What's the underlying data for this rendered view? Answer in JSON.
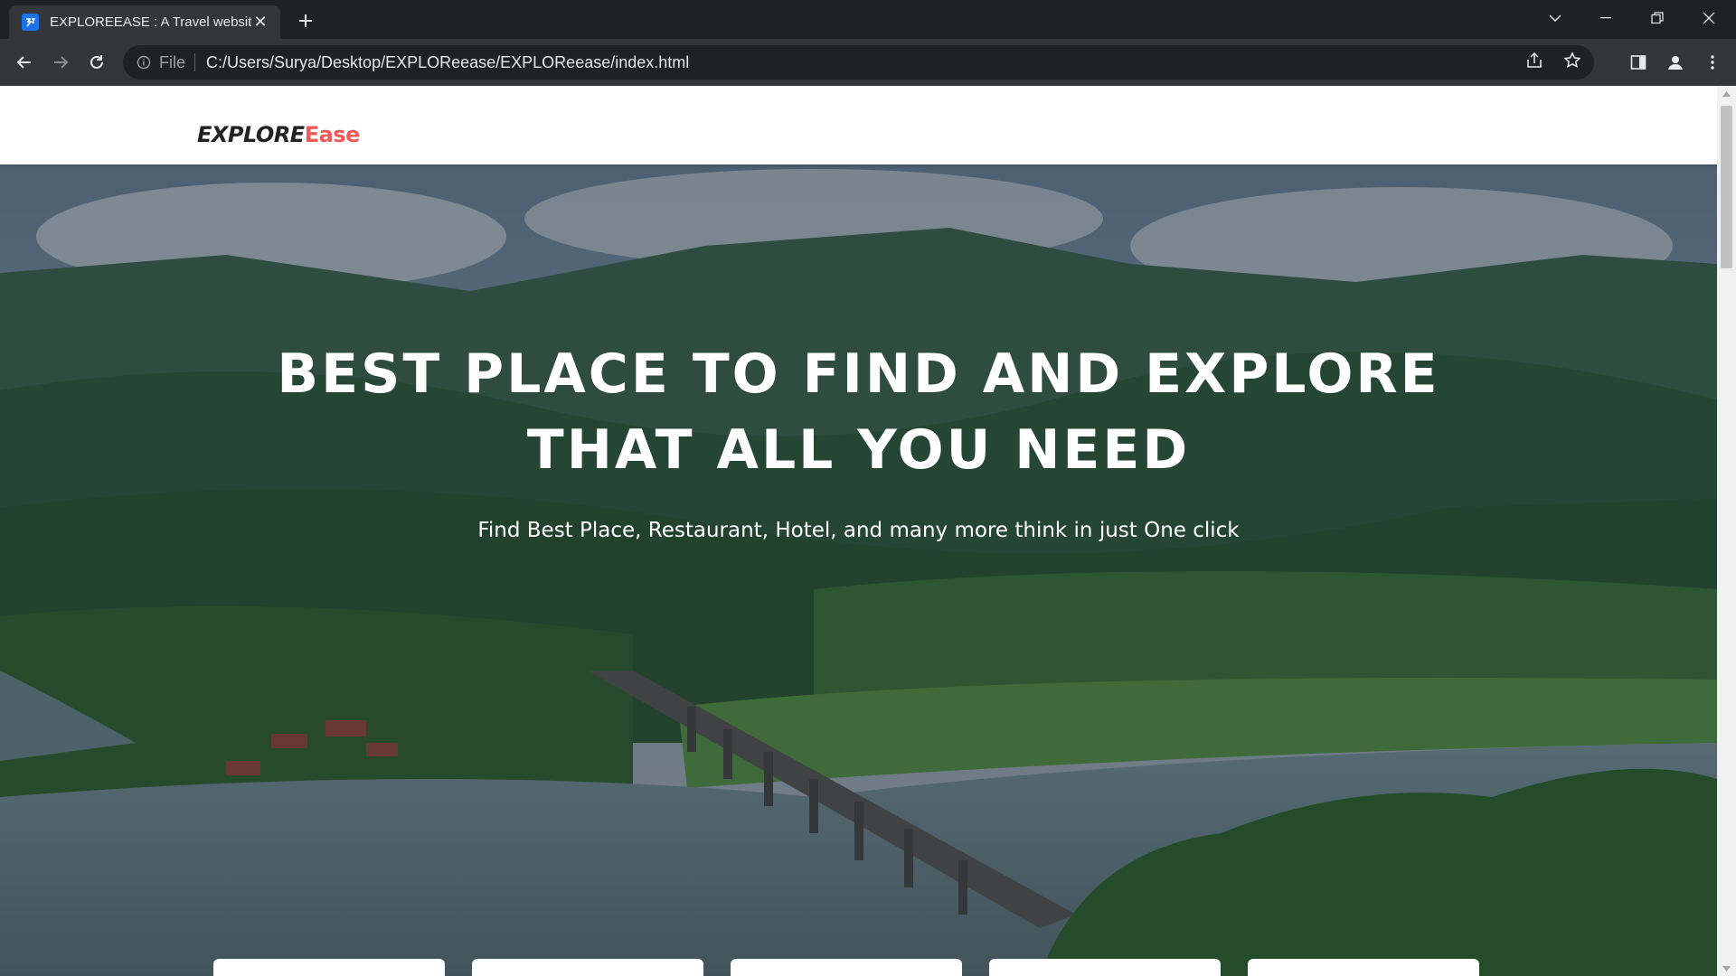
{
  "browser": {
    "tab_title": "EXPLOREEASE : A Travel website",
    "url_scheme_label": "File",
    "url": "C:/Users/Surya/Desktop/EXPLOReease/EXPLOReease/index.html"
  },
  "site": {
    "logo_part1": "EXPLORE",
    "logo_part2": "Ease",
    "hero_title_line1": "BEST PLACE TO FIND AND EXPLORE",
    "hero_title_line2": "THAT ALL YOU NEED",
    "hero_subtitle": "Find Best Place, Restaurant, Hotel, and many more think in just One click"
  },
  "colors": {
    "chrome_dark": "#202124",
    "chrome_toolbar": "#35363a",
    "logo_accent": "#f25a5a",
    "logo_text": "#222222"
  }
}
